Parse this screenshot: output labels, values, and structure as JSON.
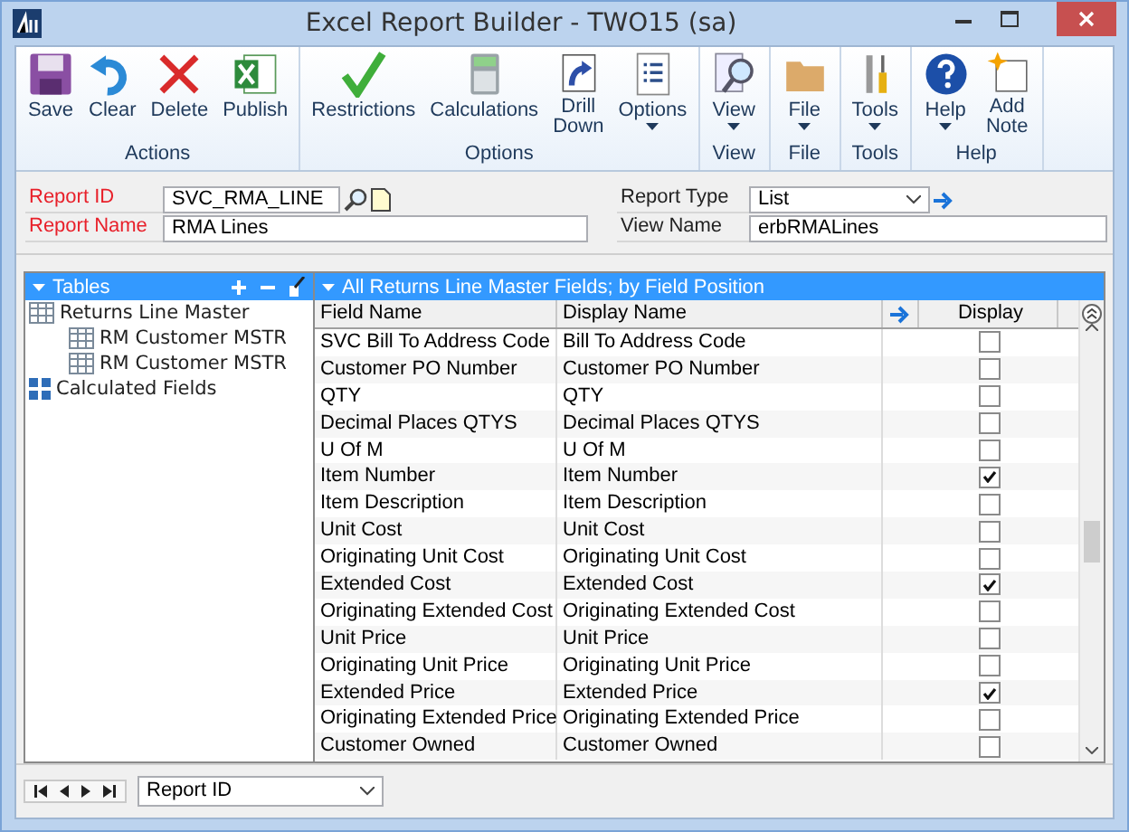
{
  "window": {
    "title": "Excel Report Builder  -  TWO15 (sa)"
  },
  "ribbon": {
    "groups": [
      {
        "label": "Actions",
        "buttons": [
          {
            "label": "Save",
            "dropdown": false
          },
          {
            "label": "Clear",
            "dropdown": false
          },
          {
            "label": "Delete",
            "dropdown": false
          },
          {
            "label": "Publish",
            "dropdown": false
          }
        ]
      },
      {
        "label": "Options",
        "buttons": [
          {
            "label": "Restrictions",
            "dropdown": false
          },
          {
            "label": "Calculations",
            "dropdown": false
          },
          {
            "label": "Drill Down",
            "dropdown": false
          },
          {
            "label": "Options",
            "dropdown": true
          }
        ]
      },
      {
        "label": "View",
        "buttons": [
          {
            "label": "View",
            "dropdown": true
          }
        ]
      },
      {
        "label": "File",
        "buttons": [
          {
            "label": "File",
            "dropdown": true
          }
        ]
      },
      {
        "label": "Tools",
        "buttons": [
          {
            "label": "Tools",
            "dropdown": true
          }
        ]
      },
      {
        "label": "Help",
        "buttons": [
          {
            "label": "Help",
            "dropdown": true
          },
          {
            "label": "Add Note",
            "dropdown": false
          }
        ]
      }
    ]
  },
  "form": {
    "report_id": {
      "label": "Report ID",
      "value": "SVC_RMA_LINE",
      "required": true
    },
    "report_name": {
      "label": "Report Name",
      "value": "RMA Lines",
      "required": true
    },
    "report_type": {
      "label": "Report Type",
      "value": "List",
      "required": false
    },
    "view_name": {
      "label": "View Name",
      "value": "erbRMALines",
      "required": false
    }
  },
  "tables_panel": {
    "title": "Tables",
    "tree": [
      {
        "label": "Returns Line Master",
        "kind": "table",
        "children": [
          {
            "label": "RM Customer MSTR",
            "kind": "table"
          },
          {
            "label": "RM Customer MSTR",
            "kind": "table"
          }
        ]
      },
      {
        "label": "Calculated Fields",
        "kind": "calc"
      }
    ]
  },
  "fields_panel": {
    "title": "All Returns Line Master Fields; by Field Position",
    "columns": [
      "Field Name",
      "Display Name",
      "Display"
    ],
    "rows": [
      {
        "field_name": "SVC Bill To Address Code",
        "display_name": "Bill To Address Code",
        "display": false
      },
      {
        "field_name": "Customer PO Number",
        "display_name": "Customer PO Number",
        "display": false
      },
      {
        "field_name": "QTY",
        "display_name": "QTY",
        "display": false
      },
      {
        "field_name": "Decimal Places QTYS",
        "display_name": "Decimal Places QTYS",
        "display": false
      },
      {
        "field_name": "U Of M",
        "display_name": "U Of M",
        "display": false
      },
      {
        "field_name": "Item Number",
        "display_name": "Item Number",
        "display": true
      },
      {
        "field_name": "Item Description",
        "display_name": "Item Description",
        "display": false
      },
      {
        "field_name": "Unit Cost",
        "display_name": "Unit Cost",
        "display": false
      },
      {
        "field_name": "Originating Unit Cost",
        "display_name": "Originating Unit Cost",
        "display": false
      },
      {
        "field_name": "Extended Cost",
        "display_name": "Extended Cost",
        "display": true
      },
      {
        "field_name": "Originating Extended Cost",
        "display_name": "Originating Extended Cost",
        "display": false
      },
      {
        "field_name": "Unit Price",
        "display_name": "Unit Price",
        "display": false
      },
      {
        "field_name": "Originating Unit Price",
        "display_name": "Originating Unit Price",
        "display": false
      },
      {
        "field_name": "Extended Price",
        "display_name": "Extended Price",
        "display": true
      },
      {
        "field_name": "Originating Extended Price",
        "display_name": "Originating Extended Price",
        "display": false
      },
      {
        "field_name": "Customer Owned",
        "display_name": "Customer Owned",
        "display": false
      }
    ]
  },
  "bottom_bar": {
    "sort_by": "Report ID"
  }
}
